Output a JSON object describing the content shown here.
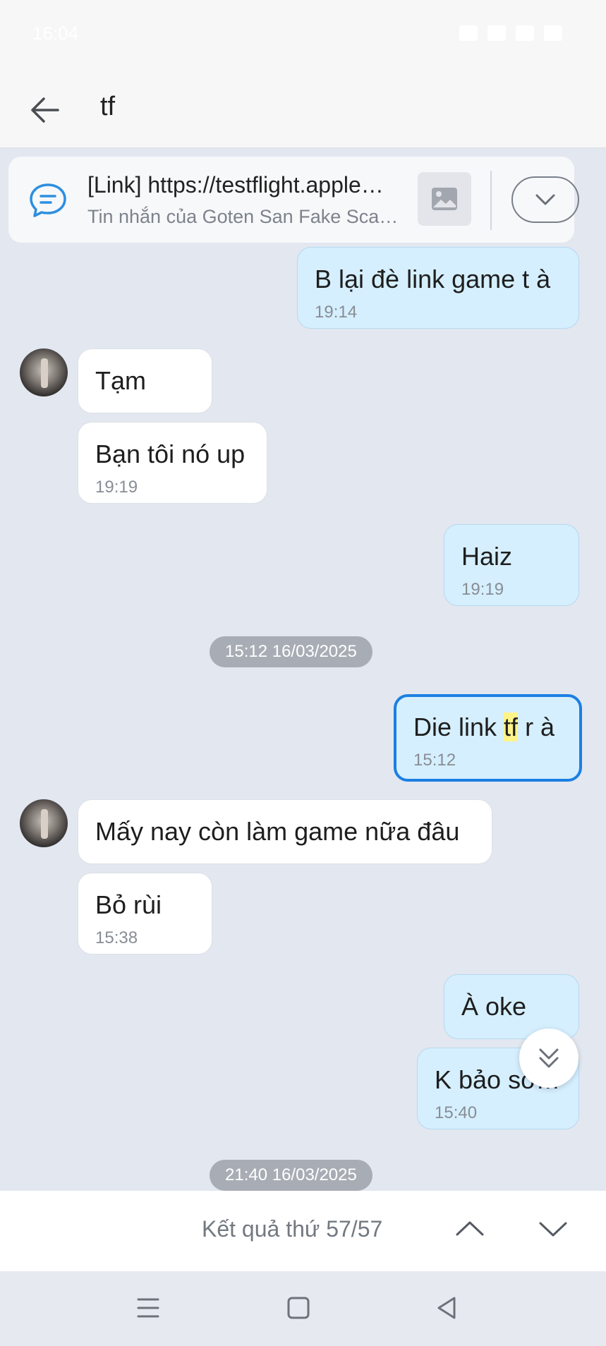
{
  "status_bar": {
    "time": "16:04"
  },
  "header": {
    "search_term": "tf"
  },
  "pinned": {
    "title": "[Link] https://testflight.apple…",
    "subtitle": "Tin nhắn của Goten San Fake Sca…"
  },
  "messages": [
    {
      "dir": "out",
      "text": "B lại đè link game t à",
      "time": "19:14"
    },
    {
      "dir": "in",
      "text": "Tạm"
    },
    {
      "dir": "in",
      "text": "Bạn tôi nó up",
      "time": "19:19"
    },
    {
      "dir": "out",
      "text": "Haiz",
      "time": "19:19"
    },
    {
      "dir": "out",
      "text_before": "Die link ",
      "highlight": "tf",
      "text_after": " r à",
      "time": "15:12"
    },
    {
      "dir": "in",
      "text": "Mấy nay còn làm game nữa đâu"
    },
    {
      "dir": "in",
      "text": "Bỏ rùi",
      "time": "15:38"
    },
    {
      "dir": "out",
      "text": "À oke"
    },
    {
      "dir": "out",
      "text": "K bảo sớm",
      "time": "15:40"
    }
  ],
  "date_separators": [
    "15:12 16/03/2025",
    "21:40 16/03/2025"
  ],
  "search_nav": {
    "result": "Kết quả thứ 57/57"
  },
  "colors": {
    "accent": "#1b7fe3",
    "outgoing": "#d5efff",
    "incoming": "#ffffff",
    "background": "#e2e7f0",
    "highlight": "#fff38a"
  }
}
